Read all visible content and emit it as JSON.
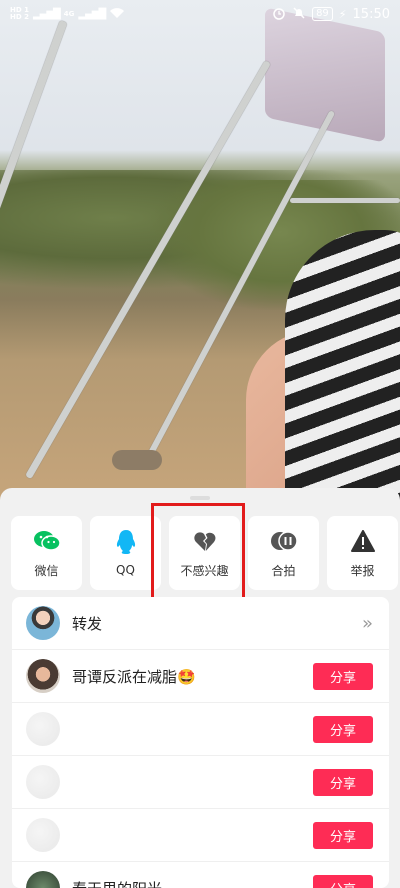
{
  "status_bar": {
    "hd1": "HD 1",
    "hd2": "HD 2",
    "signal": "4G",
    "battery": "89",
    "time": "15:50"
  },
  "share_actions": [
    {
      "label": "微信",
      "icon": "wechat-icon",
      "color": "#07c160"
    },
    {
      "label": "QQ",
      "icon": "qq-icon",
      "color": "#12b7f5"
    },
    {
      "label": "不感兴趣",
      "icon": "broken-heart-icon",
      "color": "#555555"
    },
    {
      "label": "合拍",
      "icon": "duet-icon",
      "color": "#555555"
    },
    {
      "label": "举报",
      "icon": "warning-icon",
      "color": "#333333"
    }
  ],
  "highlighted_action": "不感兴趣",
  "repost": {
    "label": "转发"
  },
  "contacts": [
    {
      "name": "哥谭反派在减脂🤩",
      "button": "分享"
    },
    {
      "name": "",
      "button": "分享"
    },
    {
      "name": "",
      "button": "分享"
    },
    {
      "name": "",
      "button": "分享"
    },
    {
      "name": "春天里的阳光",
      "button": "分享"
    }
  ],
  "accent_color": "#fe2c55"
}
